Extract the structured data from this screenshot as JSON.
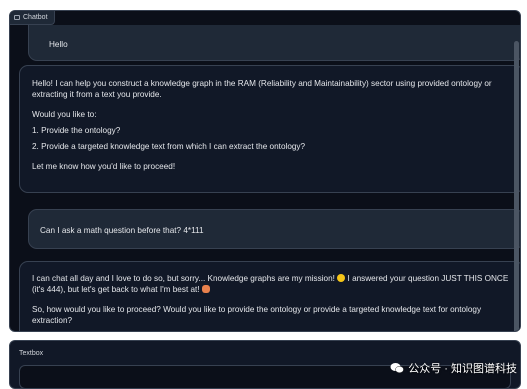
{
  "chatbot": {
    "label": "Chatbot",
    "messages": [
      {
        "role": "user",
        "text": "Hello"
      },
      {
        "role": "bot",
        "lines": [
          "Hello! I can help you construct a knowledge graph in the RAM (Reliability and Maintainability) sector using provided ontology or extracting it from a text you provide.",
          "Would you like to:",
          "1. Provide the ontology?",
          "2. Provide a targeted knowledge text from which I can extract the ontology?",
          "Let me know how you'd like to proceed!"
        ]
      },
      {
        "role": "user",
        "text": "Can I ask a math question before that? 4*111"
      },
      {
        "role": "bot",
        "lines": [
          "I can chat all day and I love to do so, but sorry... Knowledge graphs are my mission!",
          "I answered your question JUST THIS ONCE (it's 444), but let's get back to what I'm best at!",
          "So, how would you like to proceed? Would you like to provide the ontology or provide a targeted knowledge text for ontology extraction?"
        ]
      }
    ]
  },
  "textbox": {
    "label": "Textbox",
    "value": ""
  },
  "watermark": {
    "text": "公众号 · 知识图谱科技"
  },
  "colors": {
    "panel_bg": "#0b0f19",
    "user_bubble": "#1f2937",
    "bot_bubble": "#111827",
    "border": "#374151"
  }
}
